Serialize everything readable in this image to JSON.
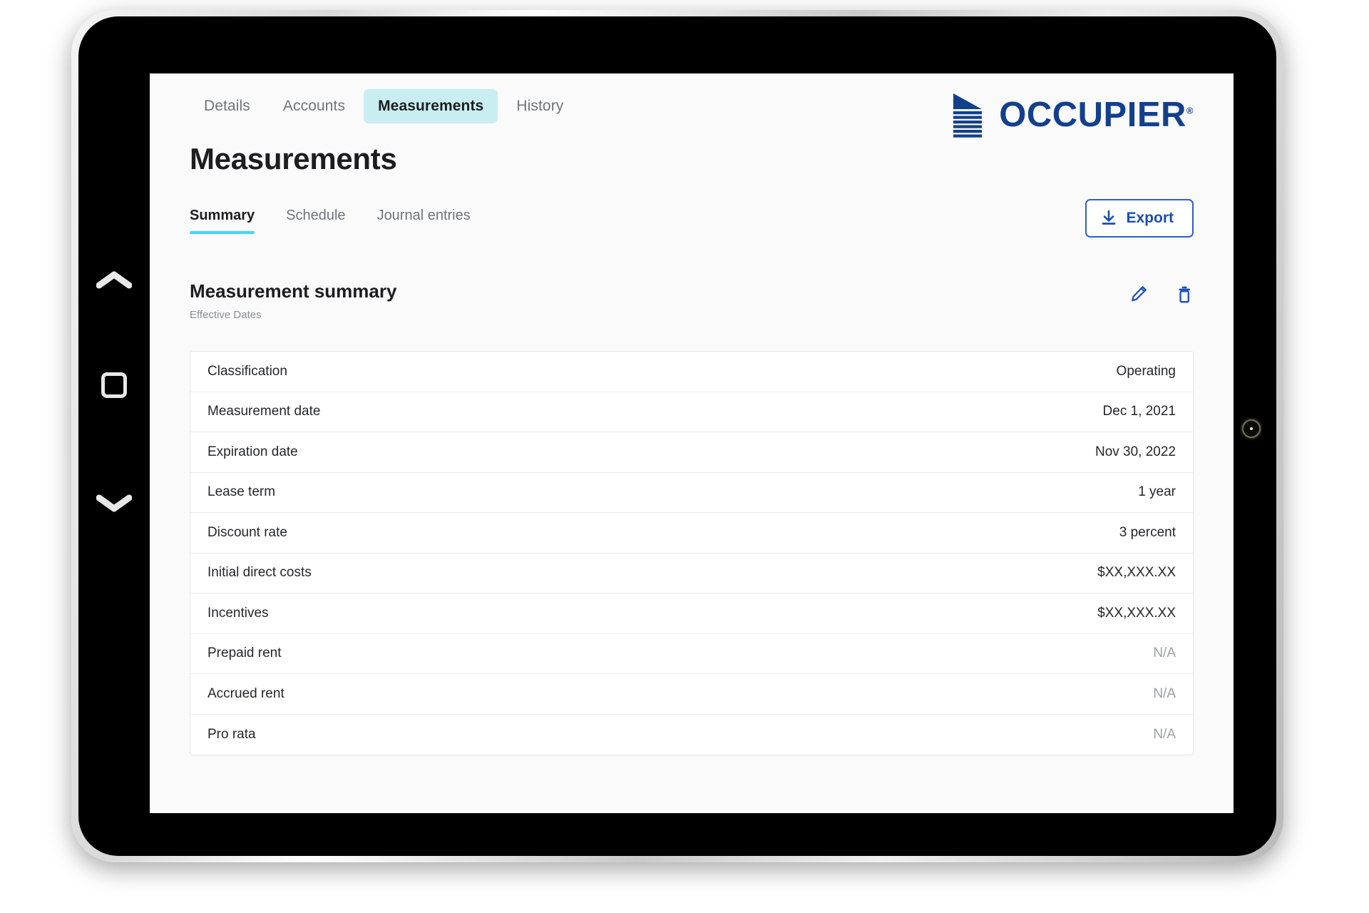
{
  "device": {
    "nav_back_icon": "chevron-up-icon",
    "nav_home_icon": "square-home-icon",
    "nav_recent_icon": "chevron-down-icon",
    "camera_icon": "camera-lens"
  },
  "top_tabs": [
    {
      "label": "Details",
      "active": false
    },
    {
      "label": "Accounts",
      "active": false
    },
    {
      "label": "Measurements",
      "active": true
    },
    {
      "label": "History",
      "active": false
    }
  ],
  "brand": {
    "name": "OCCUPIER",
    "registered_mark": "®",
    "mark_icon": "occupier-building-logo",
    "color": "#12408c"
  },
  "page": {
    "title": "Measurements"
  },
  "sub_tabs": [
    {
      "label": "Summary",
      "active": true
    },
    {
      "label": "Schedule",
      "active": false
    },
    {
      "label": "Journal entries",
      "active": false
    }
  ],
  "toolbar": {
    "export_label": "Export",
    "export_icon": "download-icon",
    "export_color": "#1b4db3"
  },
  "section": {
    "title": "Measurement summary",
    "subtitle": "Effective Dates",
    "edit_icon": "pencil-icon",
    "delete_icon": "trash-icon",
    "icon_color": "#1b4db3"
  },
  "summary_rows": [
    {
      "label": "Classification",
      "value": "Operating",
      "muted": false
    },
    {
      "label": "Measurement date",
      "value": "Dec 1, 2021",
      "muted": false
    },
    {
      "label": "Expiration date",
      "value": "Nov 30, 2022",
      "muted": false
    },
    {
      "label": "Lease term",
      "value": "1 year",
      "muted": false
    },
    {
      "label": "Discount rate",
      "value": "3 percent",
      "muted": false
    },
    {
      "label": "Initial direct costs",
      "value": "$XX,XXX.XX",
      "muted": false
    },
    {
      "label": "Incentives",
      "value": "$XX,XXX.XX",
      "muted": false
    },
    {
      "label": "Prepaid rent",
      "value": "N/A",
      "muted": true
    },
    {
      "label": "Accrued rent",
      "value": "N/A",
      "muted": true
    },
    {
      "label": "Pro rata",
      "value": "N/A",
      "muted": true
    }
  ],
  "accent": {
    "active_tab_bg": "#c9eef2",
    "underline": "#45d8e8",
    "brand_blue": "#12408c"
  }
}
